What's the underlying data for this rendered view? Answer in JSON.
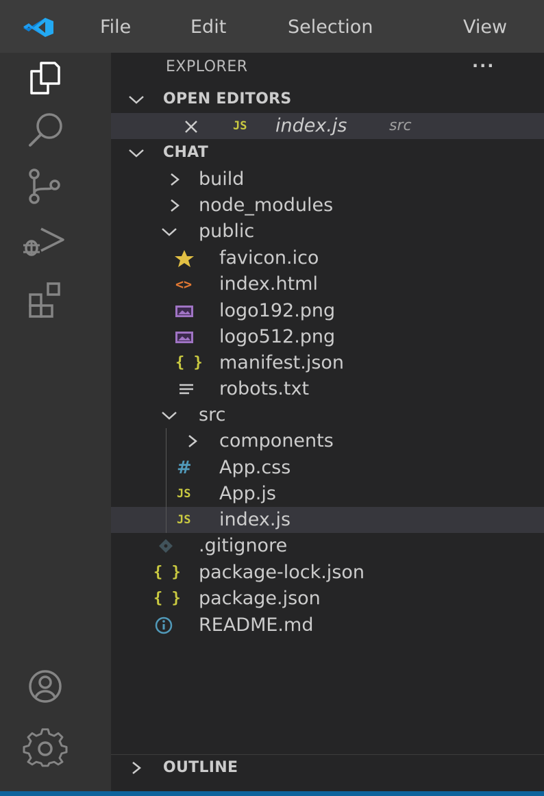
{
  "menu": {
    "items": [
      "File",
      "Edit",
      "Selection",
      "View"
    ]
  },
  "explorer": {
    "title": "EXPLORER",
    "more_actions": "..."
  },
  "open_editors": {
    "header": "OPEN EDITORS",
    "items": [
      {
        "icon_badge": "JS",
        "filename": "index.js",
        "path": "src"
      }
    ]
  },
  "workspace": {
    "header": "CHAT",
    "tree": {
      "build": "build",
      "node_modules": "node_modules",
      "public": "public",
      "favicon": "favicon.ico",
      "index_html": "index.html",
      "logo192": "logo192.png",
      "logo512": "logo512.png",
      "manifest": "manifest.json",
      "robots": "robots.txt",
      "src": "src",
      "components": "components",
      "app_css": "App.css",
      "app_js": "App.js",
      "index_js": "index.js",
      "gitignore": ".gitignore",
      "package_lock": "package-lock.json",
      "package_json": "package.json",
      "readme": "README.md"
    },
    "badges": {
      "js": "JS",
      "json": "{ }",
      "css": "#",
      "html": "<>"
    }
  },
  "outline": {
    "header": "OUTLINE"
  },
  "colors": {
    "title_bar": "#3c3c3c",
    "activity_bar": "#333333",
    "sidebar": "#252526",
    "selected_row": "#37373d",
    "js_yellow": "#cbcb41",
    "css_blue": "#519aba",
    "html_orange": "#e37933",
    "image_purple": "#a074c4",
    "accent_blue": "#0e639c"
  },
  "icons": {
    "activity_bar": [
      "explorer-icon",
      "search-icon",
      "source-control-icon",
      "run-debug-icon",
      "extensions-icon",
      "accounts-icon",
      "manage-gear-icon"
    ],
    "files": [
      "star-icon",
      "code-brackets-icon",
      "image-icon",
      "json-braces-icon",
      "text-lines-icon",
      "css-hash-icon",
      "js-icon",
      "git-icon",
      "info-icon"
    ]
  }
}
